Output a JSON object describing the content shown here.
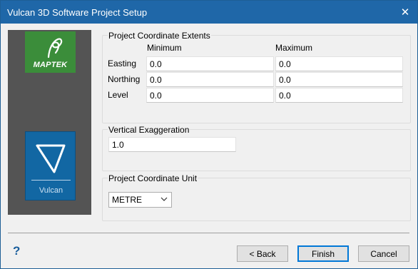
{
  "window": {
    "title": "Vulcan 3D Software Project Setup",
    "close_glyph": "✕"
  },
  "branding": {
    "maptek_logo_text": "MAPTEK",
    "vulcan_logo_text": "Vulcan"
  },
  "extents": {
    "legend": "Project Coordinate Extents",
    "col_min": "Minimum",
    "col_max": "Maximum",
    "rows": [
      {
        "label": "Easting",
        "min": "0.0",
        "max": "0.0"
      },
      {
        "label": "Northing",
        "min": "0.0",
        "max": "0.0"
      },
      {
        "label": "Level",
        "min": "0.0",
        "max": "0.0"
      }
    ]
  },
  "exaggeration": {
    "legend": "Vertical Exaggeration",
    "value": "1.0"
  },
  "unit": {
    "legend": "Project Coordinate Unit",
    "selected": "METRE"
  },
  "footer": {
    "help_glyph": "?",
    "back_label": "< Back",
    "finish_label": "Finish",
    "cancel_label": "Cancel"
  },
  "colors": {
    "titlebar": "#1f67a8",
    "maptek_green": "#3b8d3a",
    "vulcan_blue": "#1267a3",
    "side_panel": "#545454",
    "default_button_border": "#0078d7"
  }
}
